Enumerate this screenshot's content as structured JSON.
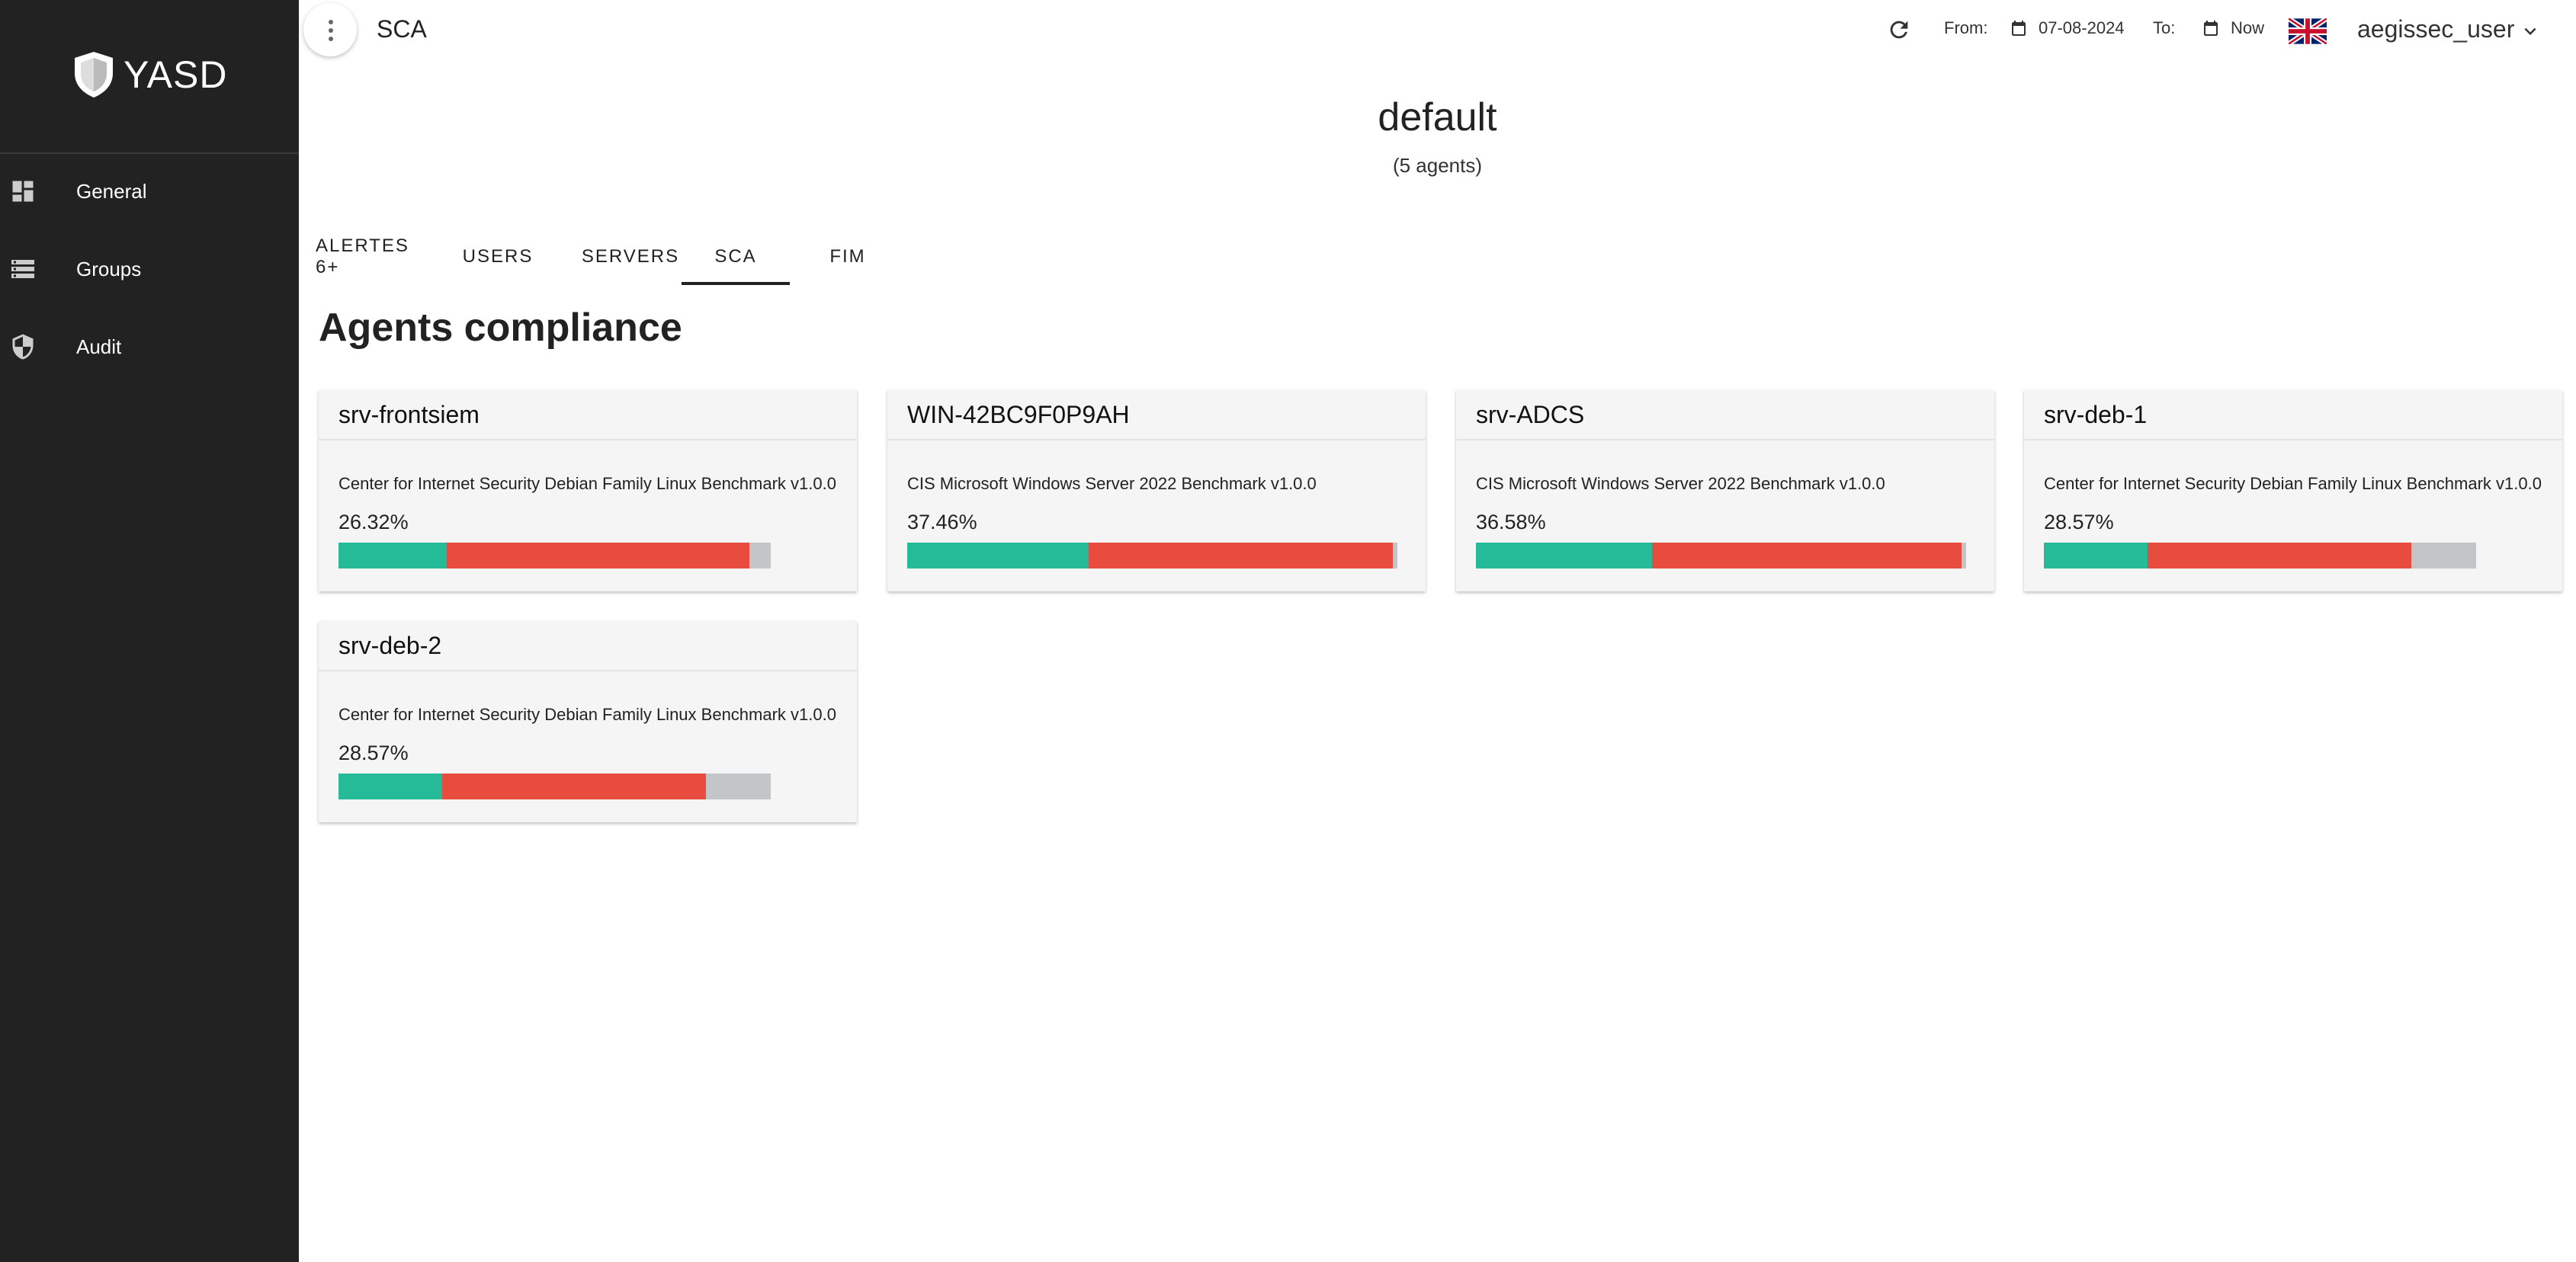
{
  "brand": {
    "name": "YASD"
  },
  "sidebar": {
    "items": [
      {
        "label": "General",
        "icon": "dashboard-icon"
      },
      {
        "label": "Groups",
        "icon": "storage-icon"
      },
      {
        "label": "Audit",
        "icon": "shield-icon"
      }
    ]
  },
  "header": {
    "title": "SCA",
    "from_label": "From:",
    "from_value": "07-08-2024",
    "to_label": "To:",
    "to_value": "Now",
    "user": "aegissec_user",
    "language_flag": "uk-flag-icon"
  },
  "group": {
    "name": "default",
    "count": "(5 agents)"
  },
  "tabs": [
    {
      "label": "ALERTES 6+"
    },
    {
      "label": "USERS"
    },
    {
      "label": "SERVERS"
    },
    {
      "label": "SCA",
      "active": true
    },
    {
      "label": "FIM"
    }
  ],
  "section_title": "Agents compliance",
  "colors": {
    "pass": "#26bb98",
    "fail": "#e74c3e",
    "not_applicable": "#c2c6c8",
    "sidebar": "#222222"
  },
  "agents": [
    {
      "name": "srv-frontsiem",
      "benchmark": "Center for Internet Security Debian Family Linux Benchmark v1.0.0",
      "score": "26.32%",
      "pass": 0.25,
      "fail": 0.7,
      "na": 0.05
    },
    {
      "name": "WIN-42BC9F0P9AH",
      "benchmark": "CIS Microsoft Windows Server 2022 Benchmark v1.0.0",
      "score": "37.46%",
      "pass": 0.37,
      "fail": 0.62,
      "na": 0.01
    },
    {
      "name": "srv-ADCS",
      "benchmark": "CIS Microsoft Windows Server 2022 Benchmark v1.0.0",
      "score": "36.58%",
      "pass": 0.36,
      "fail": 0.63,
      "na": 0.01
    },
    {
      "name": "srv-deb-1",
      "benchmark": "Center for Internet Security Debian Family Linux Benchmark v1.0.0",
      "score": "28.57%",
      "pass": 0.24,
      "fail": 0.61,
      "na": 0.15
    },
    {
      "name": "srv-deb-2",
      "benchmark": "Center for Internet Security Debian Family Linux Benchmark v1.0.0",
      "score": "28.57%",
      "pass": 0.24,
      "fail": 0.61,
      "na": 0.15
    }
  ]
}
